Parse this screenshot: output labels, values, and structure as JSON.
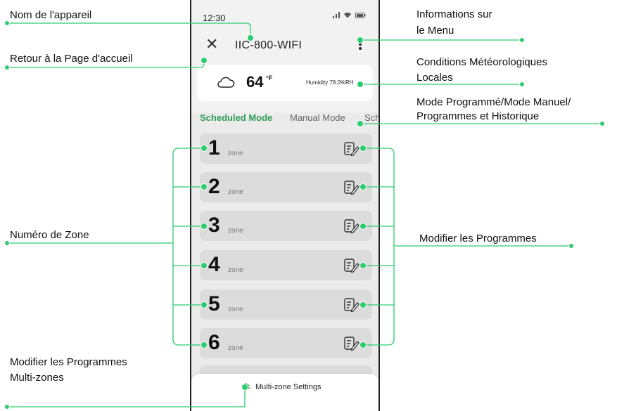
{
  "status_bar": {
    "time": "12:30"
  },
  "header": {
    "device_name": "IIC-800-WIFI",
    "close_symbol": "✕"
  },
  "weather": {
    "temperature": "64",
    "unit": "°F",
    "humidity": "Humidity  78.0%RH"
  },
  "tabs": [
    "Scheduled Mode",
    "Manual Mode",
    "Sch"
  ],
  "zones": [
    {
      "number": "1",
      "label": "zone"
    },
    {
      "number": "2",
      "label": "zone"
    },
    {
      "number": "3",
      "label": "zone"
    },
    {
      "number": "4",
      "label": "zone"
    },
    {
      "number": "5",
      "label": "zone"
    },
    {
      "number": "6",
      "label": "zone"
    }
  ],
  "bottom": {
    "multizone_label": "Multi-zone Settings"
  },
  "annotations": {
    "device_name": "Nom de l'appareil",
    "home": "Retour à la Page d'accueil",
    "menu_line1": "Informations sur",
    "menu_line2": "le Menu",
    "weather_line1": "Conditions Météorologiques",
    "weather_line2": "Locales",
    "modes_line1": "Mode Programmé/Mode Manuel/",
    "modes_line2": "Programmes et Historique",
    "zone_number": "Numéro de Zone",
    "edit_programs": "Modifier les Programmes",
    "multizone_line1": "Modifier les Programmes",
    "multizone_line2": "Multi-zones"
  },
  "colors": {
    "accent": "#2e9e55",
    "annotation": "#2ecc71"
  }
}
